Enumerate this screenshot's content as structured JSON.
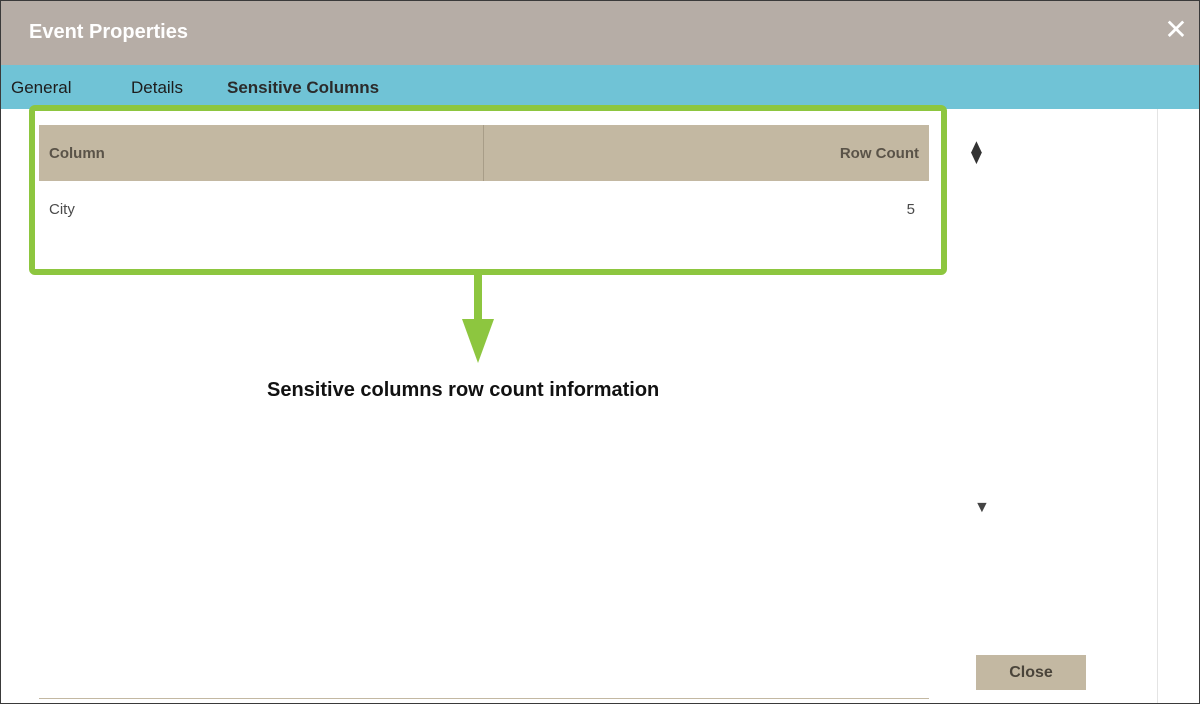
{
  "dialog": {
    "title": "Event Properties",
    "close_icon": "close-icon"
  },
  "tabs": [
    {
      "label": "General",
      "active": false
    },
    {
      "label": "Details",
      "active": false
    },
    {
      "label": "Sensitive Columns",
      "active": true
    }
  ],
  "table": {
    "headers": [
      "Column",
      "Row Count"
    ],
    "rows": [
      {
        "column": "City",
        "row_count": "5"
      }
    ]
  },
  "annotation": {
    "text": "Sensitive columns row count information",
    "highlight_color": "#8dc63f"
  },
  "footer": {
    "close_label": "Close"
  },
  "colors": {
    "titlebar": "#b6ada6",
    "tabbar": "#70c3d6",
    "table_header": "#c3b8a2"
  }
}
